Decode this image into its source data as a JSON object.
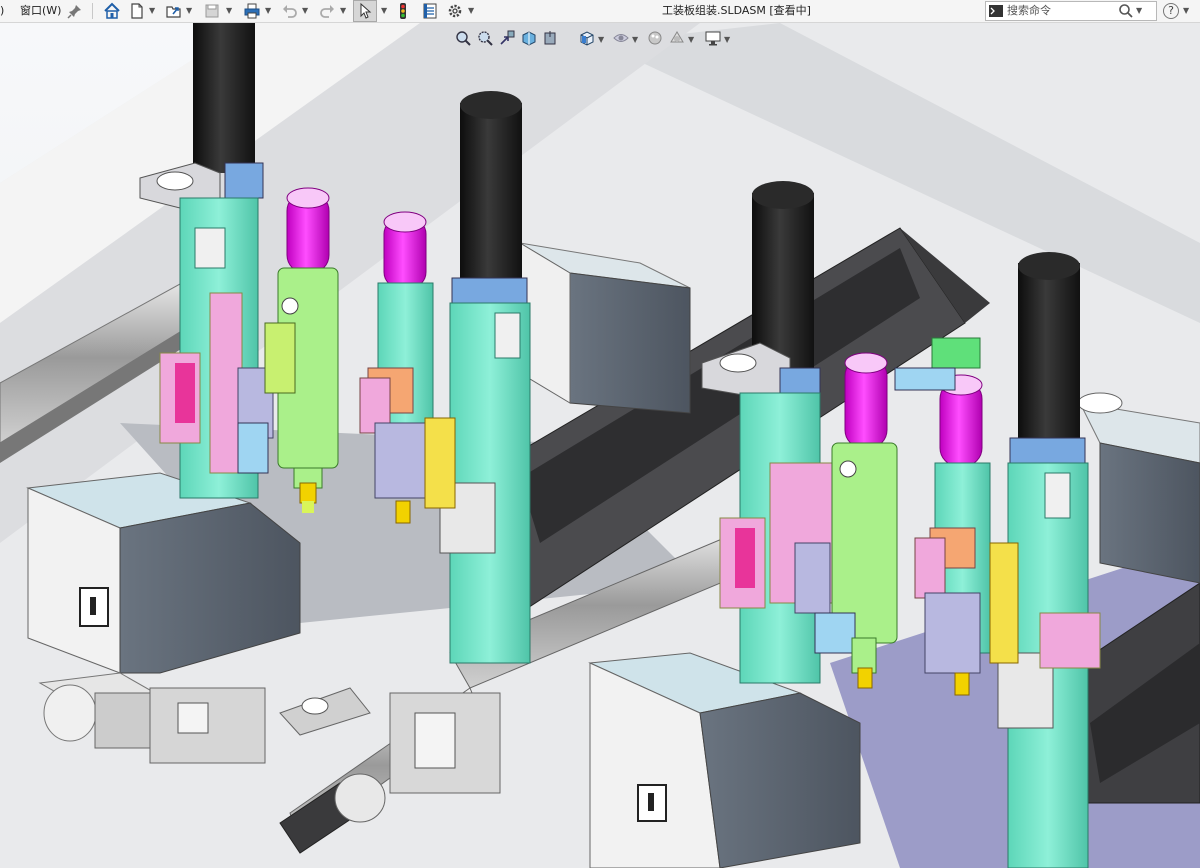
{
  "titlebar": {
    "menu_fragment": ")",
    "window_menu": "窗口(W)",
    "document_title": "工装板组装.SLDASM [查看中]",
    "search_placeholder": "搜索命令",
    "help_label": "?"
  },
  "icons": {
    "pin": "pin-icon",
    "home": "home-icon",
    "new": "new-document-icon",
    "open": "open-folder-icon",
    "save": "save-icon",
    "print": "print-icon",
    "undo": "undo-icon",
    "redo": "redo-icon",
    "select": "select-arrow-icon",
    "rebuild": "traffic-light-icon",
    "file_properties": "file-properties-icon",
    "options": "gear-icon",
    "command_prompt": "command-prompt-icon",
    "search": "search-icon",
    "help": "help-icon"
  },
  "headsup_toolbar": [
    "zoom-to-fit-icon",
    "zoom-to-area-icon",
    "previous-view-icon",
    "section-view-icon",
    "dynamic-annotation-icon",
    "view-orientation-icon",
    "display-style-icon",
    "hide-show-items-icon",
    "edit-appearance-icon",
    "apply-scene-icon",
    "view-settings-icon"
  ],
  "colors": {
    "teal": "#6fe3c8",
    "magenta": "#ee15ee",
    "black_motor": "#1f1f1f",
    "light_green": "#aaf08a",
    "pink": "#f0a8dc",
    "orange": "#f5a672",
    "gray_block": "#5a6470",
    "dark_rail": "#3a3a3c",
    "lavender": "#a8a8d8",
    "light_blue": "#9fd5f2",
    "lime": "#d9f55a",
    "bracket": "#d8d8dc"
  }
}
